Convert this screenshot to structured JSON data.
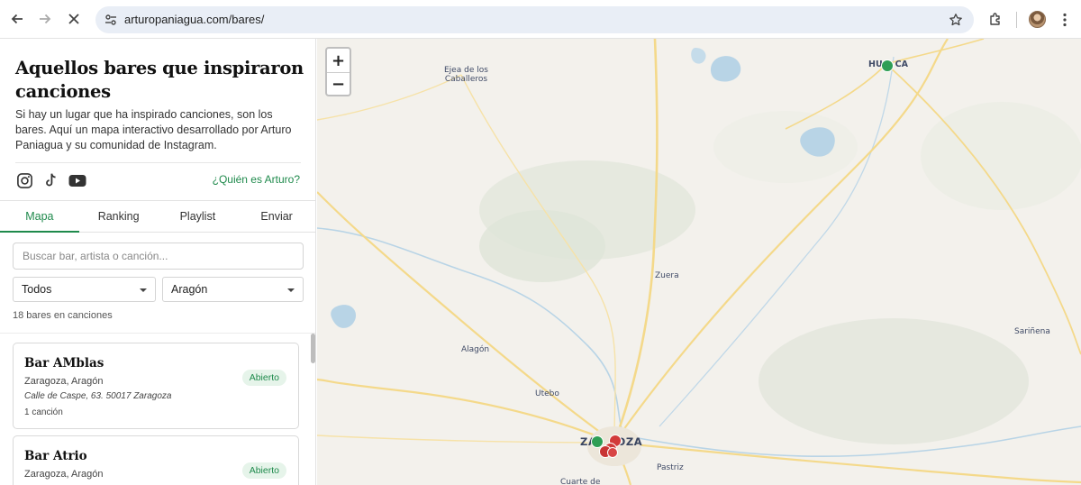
{
  "browser": {
    "url": "arturopaniagua.com/bares/"
  },
  "sidebar": {
    "title": "Aquellos bares que inspiraron canciones",
    "description": "Si hay un lugar que ha inspirado canciones, son los bares. Aquí un mapa interactivo desarrollado por Arturo Paniagua y su comunidad de Instagram.",
    "who_link": "¿Quién es Arturo?",
    "social_icons": [
      "instagram-icon",
      "tiktok-icon",
      "youtube-icon"
    ],
    "tabs": [
      {
        "label": "Mapa",
        "active": true
      },
      {
        "label": "Ranking",
        "active": false
      },
      {
        "label": "Playlist",
        "active": false
      },
      {
        "label": "Enviar",
        "active": false
      }
    ],
    "search_placeholder": "Buscar bar, artista o canción...",
    "filter_type": "Todos",
    "filter_region": "Aragón",
    "count_text": "18 bares en canciones",
    "bars": [
      {
        "name": "Bar AMblas",
        "location": "Zaragoza, Aragón",
        "address": "Calle de Caspe, 63. 50017 Zaragoza",
        "songs": "1 canción",
        "status": "Abierto"
      },
      {
        "name": "Bar Atrio",
        "location": "Zaragoza, Aragón",
        "status": "Abierto"
      }
    ]
  },
  "map": {
    "zoom_in": "+",
    "zoom_out": "−",
    "places": [
      {
        "label": "Ejea de los",
        "label2": "Caballeros"
      },
      {
        "label": "HU",
        "label2": "CA"
      },
      {
        "label": "Zuera"
      },
      {
        "label": "Alagón"
      },
      {
        "label": "Utebo"
      },
      {
        "label": "Sariñena"
      },
      {
        "label": "ZA",
        "label2": "OZA"
      },
      {
        "label": "Pastriz"
      },
      {
        "label": "Cuarte de"
      }
    ],
    "colors": {
      "open": "#2e9e55",
      "closed": "#d23a3a",
      "road": "#f4d98a",
      "water": "#b8d4e6",
      "land": "#f3f1ec"
    }
  }
}
